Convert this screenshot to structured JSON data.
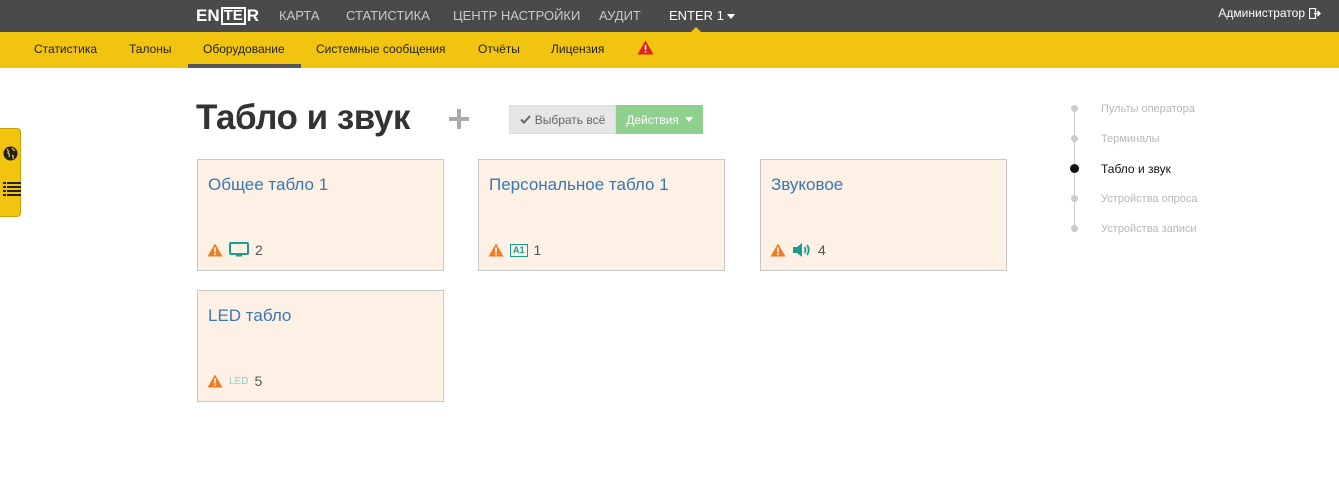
{
  "topbar": {
    "logo": {
      "pre": "EN",
      "box": "TE",
      "post": "R"
    },
    "nav": [
      "КАРТА",
      "СТАТИСТИКА",
      "ЦЕНТР НАСТРОЙКИ",
      "АУДИТ"
    ],
    "current": "ENTER 1",
    "user": "Администратор"
  },
  "subnav": [
    "Статистика",
    "Талоны",
    "Оборудование",
    "Системные сообщения",
    "Отчёты",
    "Лицензия"
  ],
  "page": {
    "title": "Табло и звук",
    "select_all": "Выбрать всё",
    "actions": "Действия"
  },
  "cards": [
    {
      "name": "Общее табло 1",
      "icon": "monitor-icon",
      "count": "2"
    },
    {
      "name": "Персональное табло 1",
      "icon": "a1-badge",
      "badge": "A1",
      "count": "1"
    },
    {
      "name": "Звуковое",
      "icon": "speaker-icon",
      "count": "4"
    },
    {
      "name": "LED табло",
      "icon": "led-label",
      "badge": "LED",
      "count": "5"
    }
  ],
  "steps": [
    "Пульты оператора",
    "Терминалы",
    "Табло и звук",
    "Устройства опроса",
    "Устройства записи"
  ],
  "colors": {
    "topbar": "#4a4a4a",
    "accent": "#f1c40f",
    "card_bg": "#fdf1e6",
    "link": "#3a77b6",
    "warning": "#f07b21",
    "teal": "#1a9e8f",
    "action_btn": "#8fd08f"
  }
}
